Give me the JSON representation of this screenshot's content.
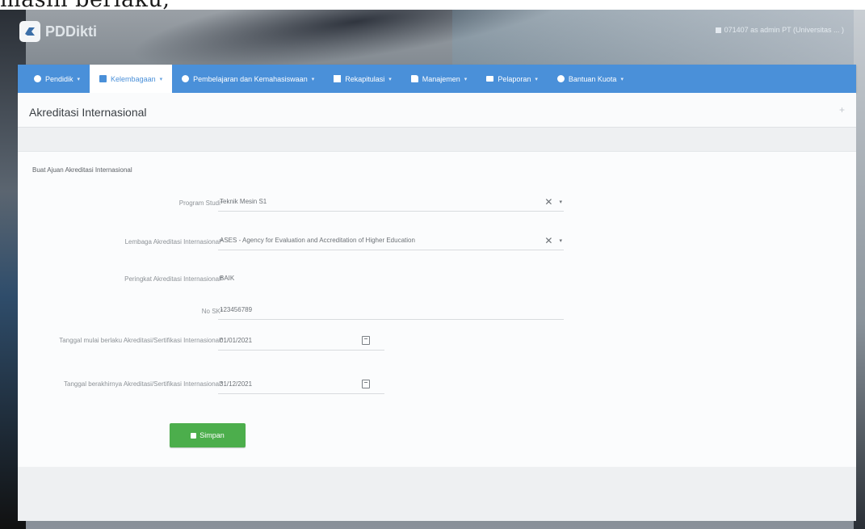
{
  "caption": "masih berlaku;",
  "app": {
    "brand": "PDDikti",
    "user_text": "071407 as admin PT (Universitas ... )"
  },
  "nav": [
    {
      "label": "Pendidik",
      "icon": "user-icon"
    },
    {
      "label": "Kelembagaan",
      "icon": "calendar-icon",
      "active": true
    },
    {
      "label": "Pembelajaran dan Kemahasiswaan",
      "icon": "user-icon"
    },
    {
      "label": "Rekapitulasi",
      "icon": "square-icon"
    },
    {
      "label": "Manajemen",
      "icon": "file-icon"
    },
    {
      "label": "Pelaporan",
      "icon": "folder-icon"
    },
    {
      "label": "Bantuan Kuota",
      "icon": "user-icon"
    }
  ],
  "page": {
    "title": "Akreditasi Internasional",
    "plus": "+"
  },
  "form": {
    "heading": "Buat Ajuan Akreditasi Internasional",
    "fields": {
      "program_studi": {
        "label": "Program Studi*",
        "value": "Teknik Mesin S1"
      },
      "lembaga": {
        "label": "Lembaga Akreditasi Internasional*",
        "value": "ASES - Agency for Evaluation and Accreditation of Higher Education"
      },
      "peringkat": {
        "label": "Peringkat Akreditasi Internasional*",
        "value": "BAIK"
      },
      "no_sk": {
        "label": "No SK*",
        "value": "123456789"
      },
      "tanggal_mulai": {
        "label": "Tanggal mulai berlaku Akreditasi/Sertifikasi Internasional*",
        "value": "01/01/2021"
      },
      "tanggal_akhir": {
        "label": "Tanggal berakhirnya Akreditasi/Sertifikasi Internasional*",
        "value": "31/12/2021"
      }
    },
    "save_label": "Simpan"
  },
  "colors": {
    "nav": "#4a90d9",
    "save": "#4cae4c",
    "content_bg": "#eef0f2"
  }
}
